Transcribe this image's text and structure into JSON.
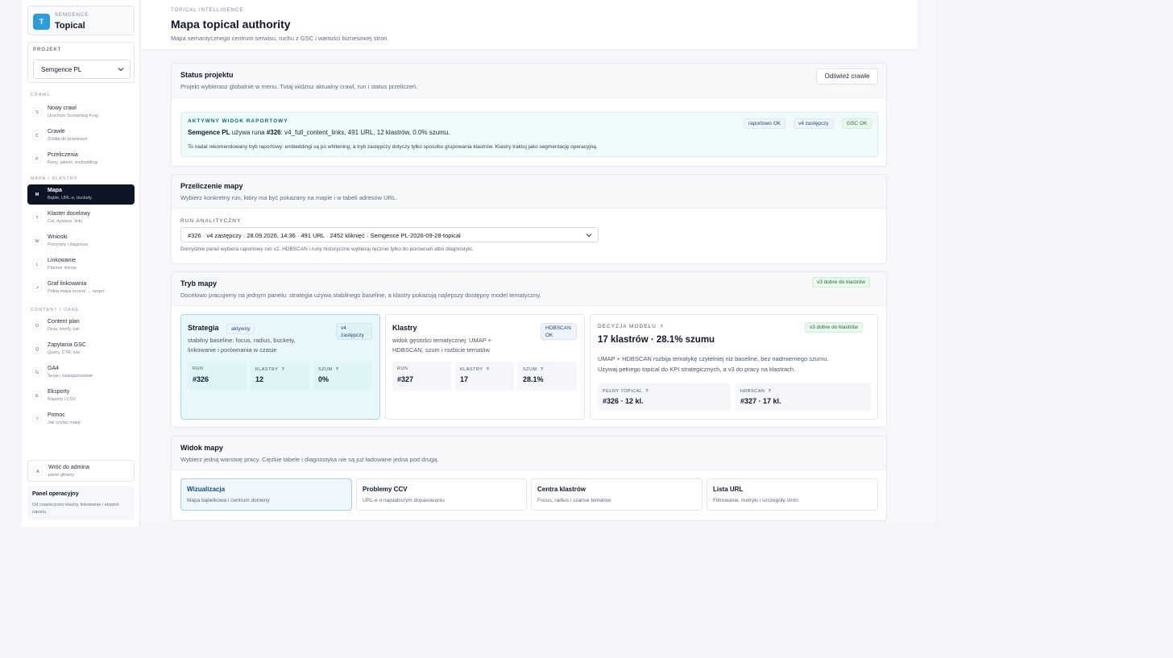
{
  "brand": {
    "logo": "T",
    "kicker": "SEMGENCE",
    "title": "Topical"
  },
  "project": {
    "label": "PROJEKT",
    "value": "Semgence PL"
  },
  "sidebar": {
    "sections": [
      "CRAWL",
      "MAPA I KLASTRY",
      "CONTENT I DANE"
    ],
    "items": [
      {
        "icon": "S",
        "title": "Nowy crawl",
        "sub": "Uruchom Screaming Frog"
      },
      {
        "icon": "C",
        "title": "Crawle",
        "sub": "Źródła do przeliczeń"
      },
      {
        "icon": "P",
        "title": "Przeliczenia",
        "sub": "Runy, jakość, embeddingi"
      },
      {
        "icon": "M",
        "title": "Mapa",
        "sub": "Bąble, URL-e, buckety"
      },
      {
        "icon": "T",
        "title": "Klaster docelowy",
        "sub": "Cel, dystans, linki"
      },
      {
        "icon": "W",
        "title": "Wnioski",
        "sub": "Priorytety i diagnoza"
      },
      {
        "icon": "L",
        "title": "Linkowanie",
        "sub": "Planner linków"
      },
      {
        "icon": "↗",
        "title": "Graf linkowania",
        "sub": "Pełna mapa source → target"
      },
      {
        "icon": "O",
        "title": "Content plan",
        "sub": "Drzw, briefy, luki"
      },
      {
        "icon": "Q",
        "title": "Zapytania GSC",
        "sub": "Query, CTR, luki"
      },
      {
        "icon": "G",
        "title": "GA4",
        "sub": "Sesje i zaangażowanie"
      },
      {
        "icon": "E",
        "title": "Eksporty",
        "sub": "Raporty i CSV"
      },
      {
        "icon": "?",
        "title": "Pomoc",
        "sub": "Jak czytać mapę"
      }
    ],
    "back": {
      "icon": "A",
      "title": "Wróć do admina",
      "sub": "panel główny"
    },
    "ops": {
      "title": "Panel operacyjny",
      "sub": "Od crawla przez klastry, linkowanie i eksport raportu."
    }
  },
  "header": {
    "kicker": "TOPICAL INTELLIGENCE",
    "title": "Mapa topical authority",
    "subtitle": "Mapa semantycznego centrum serwisu, ruchu z GSC i wartości biznesowej stron."
  },
  "status": {
    "title": "Status projektu",
    "subtitle": "Projekt wybierasz globalnie w menu. Tutaj widzisz aktualny crawl, run i status przeliczeń.",
    "refresh": "Odśwież crawle",
    "kicker": "AKTYWNY WIDOK RAPORTOWY",
    "line1_project": "Semgence PL",
    "line1_a": " używa runa ",
    "line1_run": "#326",
    "line1_b": ": v4_full_content_links, 491 URL, 12 klastrów, 0.0% szumu.",
    "line2": "To nadal rekomendowany tryb raportowy: embeddingi są po whitening, a tryb zastępczy dotyczy tylko sposobu grupowania klastrów. Klastry traktuj jako segmentację operacyjną.",
    "chips": [
      "raportowo OK",
      "v4 zastępczy",
      "GSC OK"
    ]
  },
  "recalc": {
    "title": "Przeliczenie mapy",
    "subtitle": "Wybierz konkretny run, który ma być pokazany na mapie i w tabeli adresów URL.",
    "label": "RUN ANALITYCZNY",
    "value": "#326 · v4 zastępczy · 28.09.2026, 14:36 · 491 URL · 2452 kliknięć · Semgence PL-2026-09-28-topical",
    "note": "Domyślnie panel wybiera raportowy run v2. HDBSCAN i runy historyczne wybieraj ręcznie tylko do porównań albo diagnostyki."
  },
  "mode": {
    "title": "Tryb mapy",
    "subtitle": "Docelowo pracujemy na jednym panelu: strategia używa stabilnego baseline, a klastry pokazują najlepszy dostępny model tematyczny.",
    "badge": "v3 dobre do klastrów",
    "strategy": {
      "title": "Strategia",
      "active": "aktywny",
      "tag1": "v4",
      "tag2": "zastępczy",
      "desc1": "stabilny baseline: focus, radius, buckety,",
      "desc2": "linkowanie i porównania w czasie",
      "stats": [
        {
          "label": "RUN",
          "value": "#326"
        },
        {
          "label": "KLASTRY",
          "value": "12"
        },
        {
          "label": "SZUM",
          "value": "0%"
        }
      ]
    },
    "clusters": {
      "title": "Klastry",
      "tag1": "HDBSCAN",
      "tag2": "OK",
      "desc1": "widok gęstości tematycznej: UMAP +",
      "desc2": "HDBSCAN, szum i rozbicie tematów",
      "stats": [
        {
          "label": "RUN",
          "value": "#327"
        },
        {
          "label": "KLASTRY",
          "value": "17"
        },
        {
          "label": "SZUM",
          "value": "28.1%"
        }
      ]
    },
    "decision": {
      "kicker": "DECYZJA MODELU",
      "badge": "v3 dobre do klastrów",
      "headline": "17 klastrów · 28.1% szumu",
      "desc1": "UMAP + HDBSCAN rozbija tematykę czytelniej niż baseline, bez nadmiernego szumu.",
      "desc2": "Używaj pełnego topical do KPI strategicznych, a v3 do pracy na klastrach.",
      "stats": [
        {
          "label": "PEŁNY TOPICAL",
          "value": "#326 · 12 kl."
        },
        {
          "label": "HDBSCAN",
          "value": "#327 · 17 kl."
        }
      ]
    },
    "q": "?"
  },
  "view": {
    "title": "Widok mapy",
    "subtitle": "Wybierz jedną warstwę pracy. Ciężkie tabele i diagnostyka nie są już ładowane jedna pod drugą.",
    "tabs": [
      {
        "title": "Wizualizacja",
        "sub": "Mapa bąbelkowa i centrum domeny"
      },
      {
        "title": "Problemy CCV",
        "sub": "URL-e o najsłabszym dopasowaniu"
      },
      {
        "title": "Centra klastrów",
        "sub": "Focus, radius i szanse tematów"
      },
      {
        "title": "Lista URL",
        "sub": "Filtrowanie, metryki i szczegóły stron"
      }
    ]
  }
}
